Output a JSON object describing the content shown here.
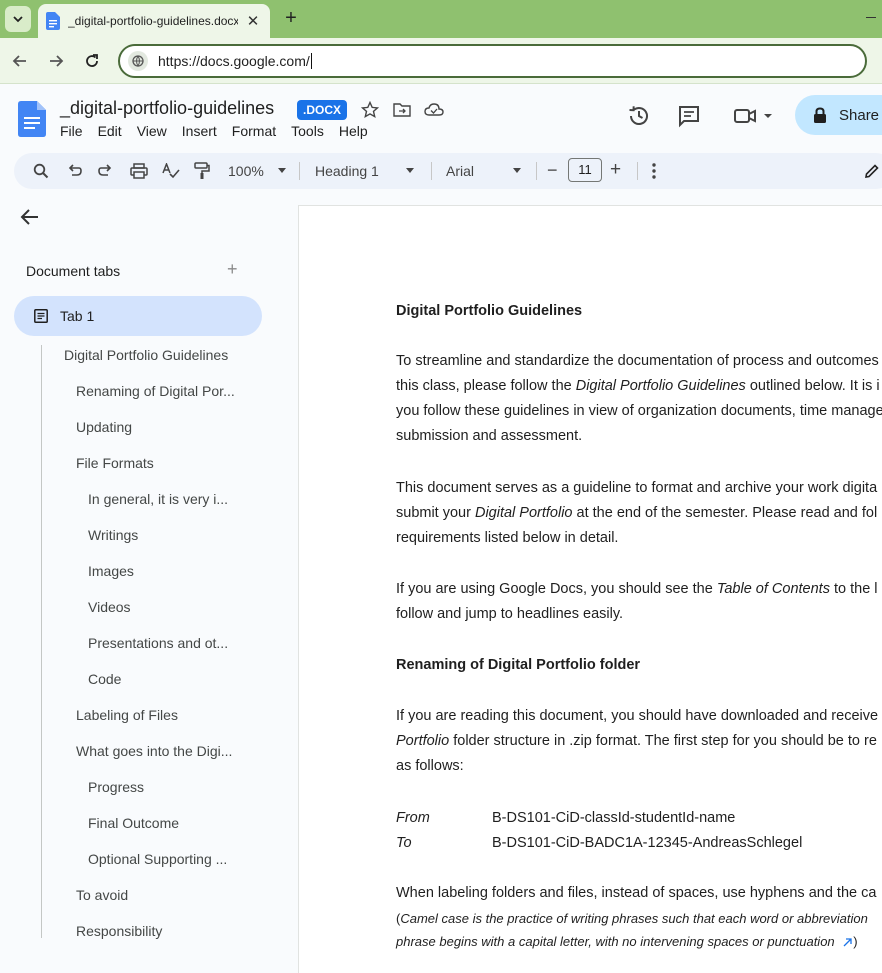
{
  "browser": {
    "tab_title": "_digital-portfolio-guidelines.docx",
    "url": "https://docs.google.com/",
    "new_tab_label": "+"
  },
  "docs": {
    "title": "_digital-portfolio-guidelines",
    "badge": ".DOCX",
    "menu": [
      "File",
      "Edit",
      "View",
      "Insert",
      "Format",
      "Tools",
      "Help"
    ],
    "share_label": "Share"
  },
  "toolbar": {
    "zoom": "100%",
    "style": "Heading 1",
    "font": "Arial",
    "font_size": "11",
    "minus": "−",
    "plus": "+"
  },
  "sidebar": {
    "header": "Document tabs",
    "add": "+",
    "tab_label": "Tab 1",
    "outline": [
      {
        "label": "Digital Portfolio Guidelines",
        "level": 1
      },
      {
        "label": "Renaming of Digital Por...",
        "level": 2
      },
      {
        "label": "Updating",
        "level": 2
      },
      {
        "label": "File Formats",
        "level": 2
      },
      {
        "label": "In general, it is very i...",
        "level": 3
      },
      {
        "label": "Writings",
        "level": 3
      },
      {
        "label": "Images",
        "level": 3
      },
      {
        "label": "Videos",
        "level": 3
      },
      {
        "label": "Presentations and ot...",
        "level": 3
      },
      {
        "label": "Code",
        "level": 3
      },
      {
        "label": "Labeling of Files",
        "level": 2
      },
      {
        "label": "What goes into the Digi...",
        "level": 2
      },
      {
        "label": "Progress",
        "level": 3
      },
      {
        "label": "Final Outcome",
        "level": 3
      },
      {
        "label": "Optional Supporting ...",
        "level": 3
      },
      {
        "label": "To avoid",
        "level": 2
      },
      {
        "label": "Responsibility",
        "level": 2
      }
    ]
  },
  "page": {
    "heading": "Digital Portfolio Guidelines",
    "p1_l1": "To streamline and standardize the documentation of process and outcomes",
    "p1_l2a": "this class, please follow the ",
    "p1_l2b": "Digital Portfolio Guidelines",
    "p1_l2c": " outlined below. It is i",
    "p1_l3": "you follow these guidelines in view of organization documents, time manage",
    "p1_l4": "submission and assessment.",
    "p2_l1": "This document serves as a guideline to format and archive your work digita",
    "p2_l2a": "submit your ",
    "p2_l2b": "Digital Portfolio",
    "p2_l2c": " at the end of the semester. Please read and fol",
    "p2_l3": "requirements listed below in detail.",
    "p3_l1a": "If you are using Google Docs, you should see the ",
    "p3_l1b": "Table of Contents",
    "p3_l1c": " to the l",
    "p3_l2": "follow and jump to headlines easily.",
    "heading2": "Renaming of Digital Portfolio folder",
    "p4_l1": "If you are reading this document, you should have downloaded and receive",
    "p4_l2a": "Portfolio",
    "p4_l2b": " folder structure in .zip format. The first step for you should be to re",
    "p4_l3": "as follows:",
    "from_label": "From",
    "from_value": "B-DS101-CiD-classId-studentId-name",
    "to_label": "To",
    "to_value": "B-DS101-CiD-BADC1A-12345-AndreasSchlegel",
    "p5_l1": "When labeling folders and files, instead of spaces, use hyphens and the ca",
    "p5_l2a": "(",
    "p5_l2b": "Camel case is the practice of writing phrases such that each word or abbreviation",
    "p5_l3": "phrase begins with a capital letter, with no intervening spaces or punctuation",
    "p5_l3_end": ")"
  },
  "colors": {
    "tabstrip": "#8fc16f",
    "share": "#c2e7ff",
    "active_tab": "#d3e3fd",
    "docx_badge": "#1a73e8"
  }
}
